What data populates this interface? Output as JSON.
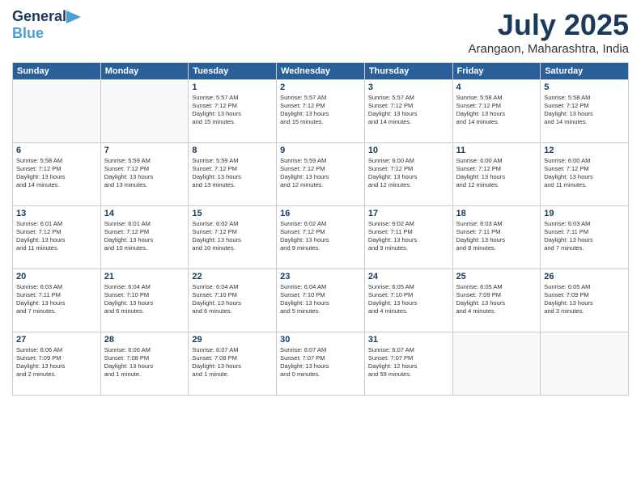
{
  "header": {
    "logo_line1": "General",
    "logo_line2": "Blue",
    "month": "July 2025",
    "location": "Arangaon, Maharashtra, India"
  },
  "weekdays": [
    "Sunday",
    "Monday",
    "Tuesday",
    "Wednesday",
    "Thursday",
    "Friday",
    "Saturday"
  ],
  "weeks": [
    [
      {
        "day": "",
        "info": ""
      },
      {
        "day": "",
        "info": ""
      },
      {
        "day": "1",
        "info": "Sunrise: 5:57 AM\nSunset: 7:12 PM\nDaylight: 13 hours\nand 15 minutes."
      },
      {
        "day": "2",
        "info": "Sunrise: 5:57 AM\nSunset: 7:12 PM\nDaylight: 13 hours\nand 15 minutes."
      },
      {
        "day": "3",
        "info": "Sunrise: 5:57 AM\nSunset: 7:12 PM\nDaylight: 13 hours\nand 14 minutes."
      },
      {
        "day": "4",
        "info": "Sunrise: 5:58 AM\nSunset: 7:12 PM\nDaylight: 13 hours\nand 14 minutes."
      },
      {
        "day": "5",
        "info": "Sunrise: 5:58 AM\nSunset: 7:12 PM\nDaylight: 13 hours\nand 14 minutes."
      }
    ],
    [
      {
        "day": "6",
        "info": "Sunrise: 5:58 AM\nSunset: 7:12 PM\nDaylight: 13 hours\nand 14 minutes."
      },
      {
        "day": "7",
        "info": "Sunrise: 5:59 AM\nSunset: 7:12 PM\nDaylight: 13 hours\nand 13 minutes."
      },
      {
        "day": "8",
        "info": "Sunrise: 5:59 AM\nSunset: 7:12 PM\nDaylight: 13 hours\nand 13 minutes."
      },
      {
        "day": "9",
        "info": "Sunrise: 5:59 AM\nSunset: 7:12 PM\nDaylight: 13 hours\nand 12 minutes."
      },
      {
        "day": "10",
        "info": "Sunrise: 6:00 AM\nSunset: 7:12 PM\nDaylight: 13 hours\nand 12 minutes."
      },
      {
        "day": "11",
        "info": "Sunrise: 6:00 AM\nSunset: 7:12 PM\nDaylight: 13 hours\nand 12 minutes."
      },
      {
        "day": "12",
        "info": "Sunrise: 6:00 AM\nSunset: 7:12 PM\nDaylight: 13 hours\nand 11 minutes."
      }
    ],
    [
      {
        "day": "13",
        "info": "Sunrise: 6:01 AM\nSunset: 7:12 PM\nDaylight: 13 hours\nand 11 minutes."
      },
      {
        "day": "14",
        "info": "Sunrise: 6:01 AM\nSunset: 7:12 PM\nDaylight: 13 hours\nand 10 minutes."
      },
      {
        "day": "15",
        "info": "Sunrise: 6:02 AM\nSunset: 7:12 PM\nDaylight: 13 hours\nand 10 minutes."
      },
      {
        "day": "16",
        "info": "Sunrise: 6:02 AM\nSunset: 7:12 PM\nDaylight: 13 hours\nand 9 minutes."
      },
      {
        "day": "17",
        "info": "Sunrise: 6:02 AM\nSunset: 7:11 PM\nDaylight: 13 hours\nand 9 minutes."
      },
      {
        "day": "18",
        "info": "Sunrise: 6:03 AM\nSunset: 7:11 PM\nDaylight: 13 hours\nand 8 minutes."
      },
      {
        "day": "19",
        "info": "Sunrise: 6:03 AM\nSunset: 7:11 PM\nDaylight: 13 hours\nand 7 minutes."
      }
    ],
    [
      {
        "day": "20",
        "info": "Sunrise: 6:03 AM\nSunset: 7:11 PM\nDaylight: 13 hours\nand 7 minutes."
      },
      {
        "day": "21",
        "info": "Sunrise: 6:04 AM\nSunset: 7:10 PM\nDaylight: 13 hours\nand 6 minutes."
      },
      {
        "day": "22",
        "info": "Sunrise: 6:04 AM\nSunset: 7:10 PM\nDaylight: 13 hours\nand 6 minutes."
      },
      {
        "day": "23",
        "info": "Sunrise: 6:04 AM\nSunset: 7:10 PM\nDaylight: 13 hours\nand 5 minutes."
      },
      {
        "day": "24",
        "info": "Sunrise: 6:05 AM\nSunset: 7:10 PM\nDaylight: 13 hours\nand 4 minutes."
      },
      {
        "day": "25",
        "info": "Sunrise: 6:05 AM\nSunset: 7:09 PM\nDaylight: 13 hours\nand 4 minutes."
      },
      {
        "day": "26",
        "info": "Sunrise: 6:05 AM\nSunset: 7:09 PM\nDaylight: 13 hours\nand 3 minutes."
      }
    ],
    [
      {
        "day": "27",
        "info": "Sunrise: 6:06 AM\nSunset: 7:09 PM\nDaylight: 13 hours\nand 2 minutes."
      },
      {
        "day": "28",
        "info": "Sunrise: 6:06 AM\nSunset: 7:08 PM\nDaylight: 13 hours\nand 1 minute."
      },
      {
        "day": "29",
        "info": "Sunrise: 6:07 AM\nSunset: 7:08 PM\nDaylight: 13 hours\nand 1 minute."
      },
      {
        "day": "30",
        "info": "Sunrise: 6:07 AM\nSunset: 7:07 PM\nDaylight: 13 hours\nand 0 minutes."
      },
      {
        "day": "31",
        "info": "Sunrise: 6:07 AM\nSunset: 7:07 PM\nDaylight: 12 hours\nand 59 minutes."
      },
      {
        "day": "",
        "info": ""
      },
      {
        "day": "",
        "info": ""
      }
    ]
  ]
}
